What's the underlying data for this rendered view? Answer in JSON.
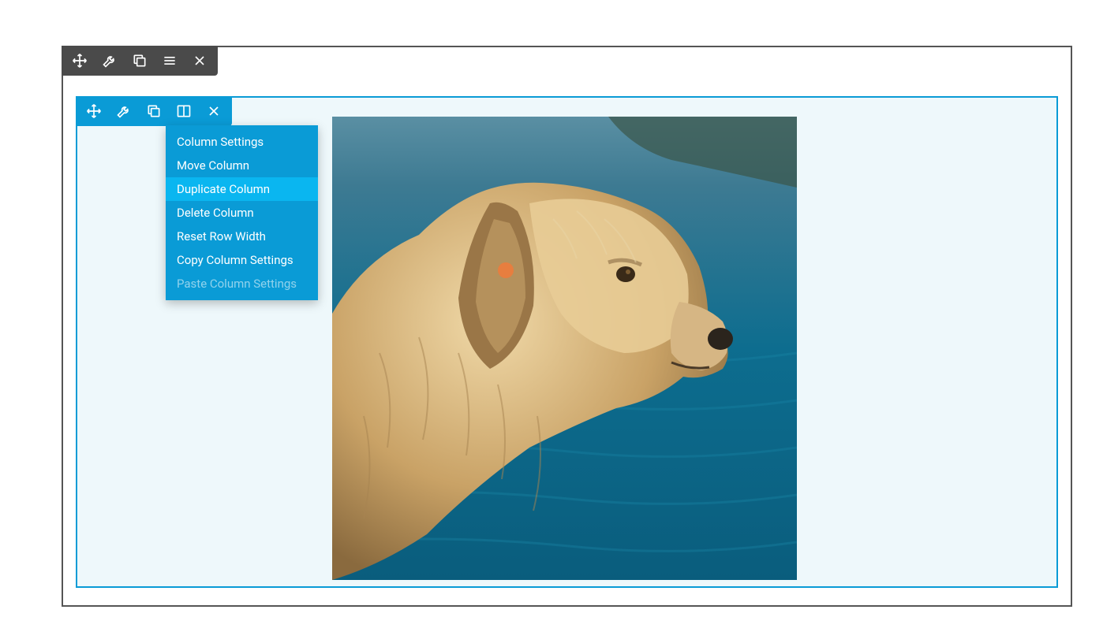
{
  "row_toolbar": {
    "icons": [
      "move-icon",
      "wrench-icon",
      "duplicate-icon",
      "menu-icon",
      "close-icon"
    ]
  },
  "col_toolbar": {
    "icons": [
      "move-icon",
      "wrench-icon",
      "duplicate-icon",
      "columns-icon",
      "close-icon"
    ]
  },
  "dropdown": {
    "items": [
      {
        "label": "Column Settings",
        "state": "normal"
      },
      {
        "label": "Move Column",
        "state": "normal"
      },
      {
        "label": "Duplicate Column",
        "state": "highlight"
      },
      {
        "label": "Delete Column",
        "state": "normal"
      },
      {
        "label": "Reset Row Width",
        "state": "normal"
      },
      {
        "label": "Copy Column Settings",
        "state": "normal"
      },
      {
        "label": "Paste Column Settings",
        "state": "disabled"
      }
    ]
  },
  "colors": {
    "row_toolbar_bg": "#4a4a4a",
    "col_toolbar_bg": "#0a9bd6",
    "highlight": "#0ab6f0",
    "inner_bg": "#eef8fb"
  },
  "image": {
    "description": "golden-retriever-dog-profile-against-teal-water"
  }
}
